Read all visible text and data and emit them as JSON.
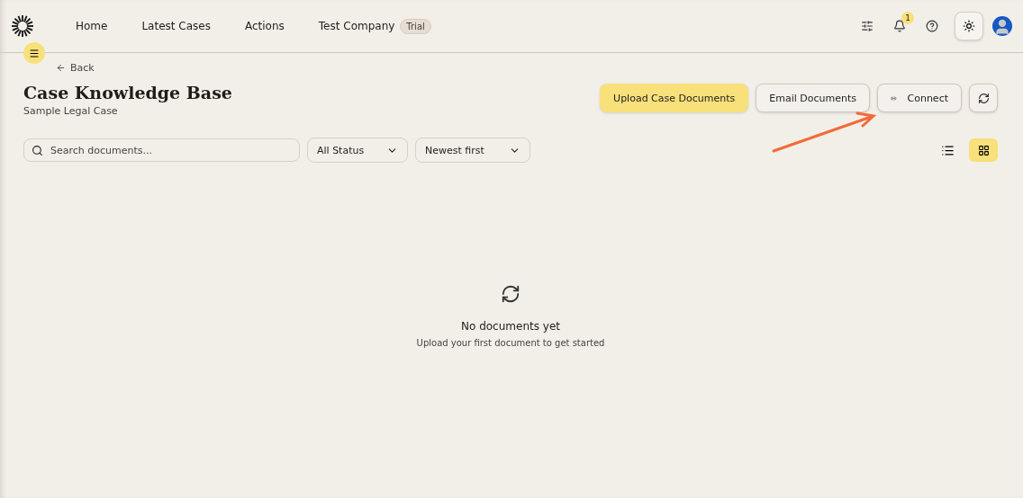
{
  "nav": {
    "items": [
      {
        "label": "Home"
      },
      {
        "label": "Latest Cases"
      },
      {
        "label": "Actions"
      }
    ],
    "company": "Test Company",
    "company_badge": "Trial",
    "notifications": "1"
  },
  "back": "Back",
  "page": {
    "title": "Case Knowledge Base",
    "subtitle": "Sample Legal Case"
  },
  "actions": [
    {
      "label": "Upload Case Documents",
      "kind": "primary"
    },
    {
      "label": "Email Documents",
      "kind": "plain"
    },
    {
      "label": "Connect",
      "kind": "link"
    },
    {
      "kind": "refresh"
    }
  ],
  "search": {
    "placeholder": "Search documents..."
  },
  "filters": [
    {
      "value": "All Status"
    },
    {
      "value": "Newest first"
    }
  ],
  "views": [
    {
      "kind": "list",
      "selected": false
    },
    {
      "kind": "grid",
      "selected": true
    }
  ],
  "empty": {
    "title": "No documents yet",
    "text": "Upload your first document to get started"
  }
}
